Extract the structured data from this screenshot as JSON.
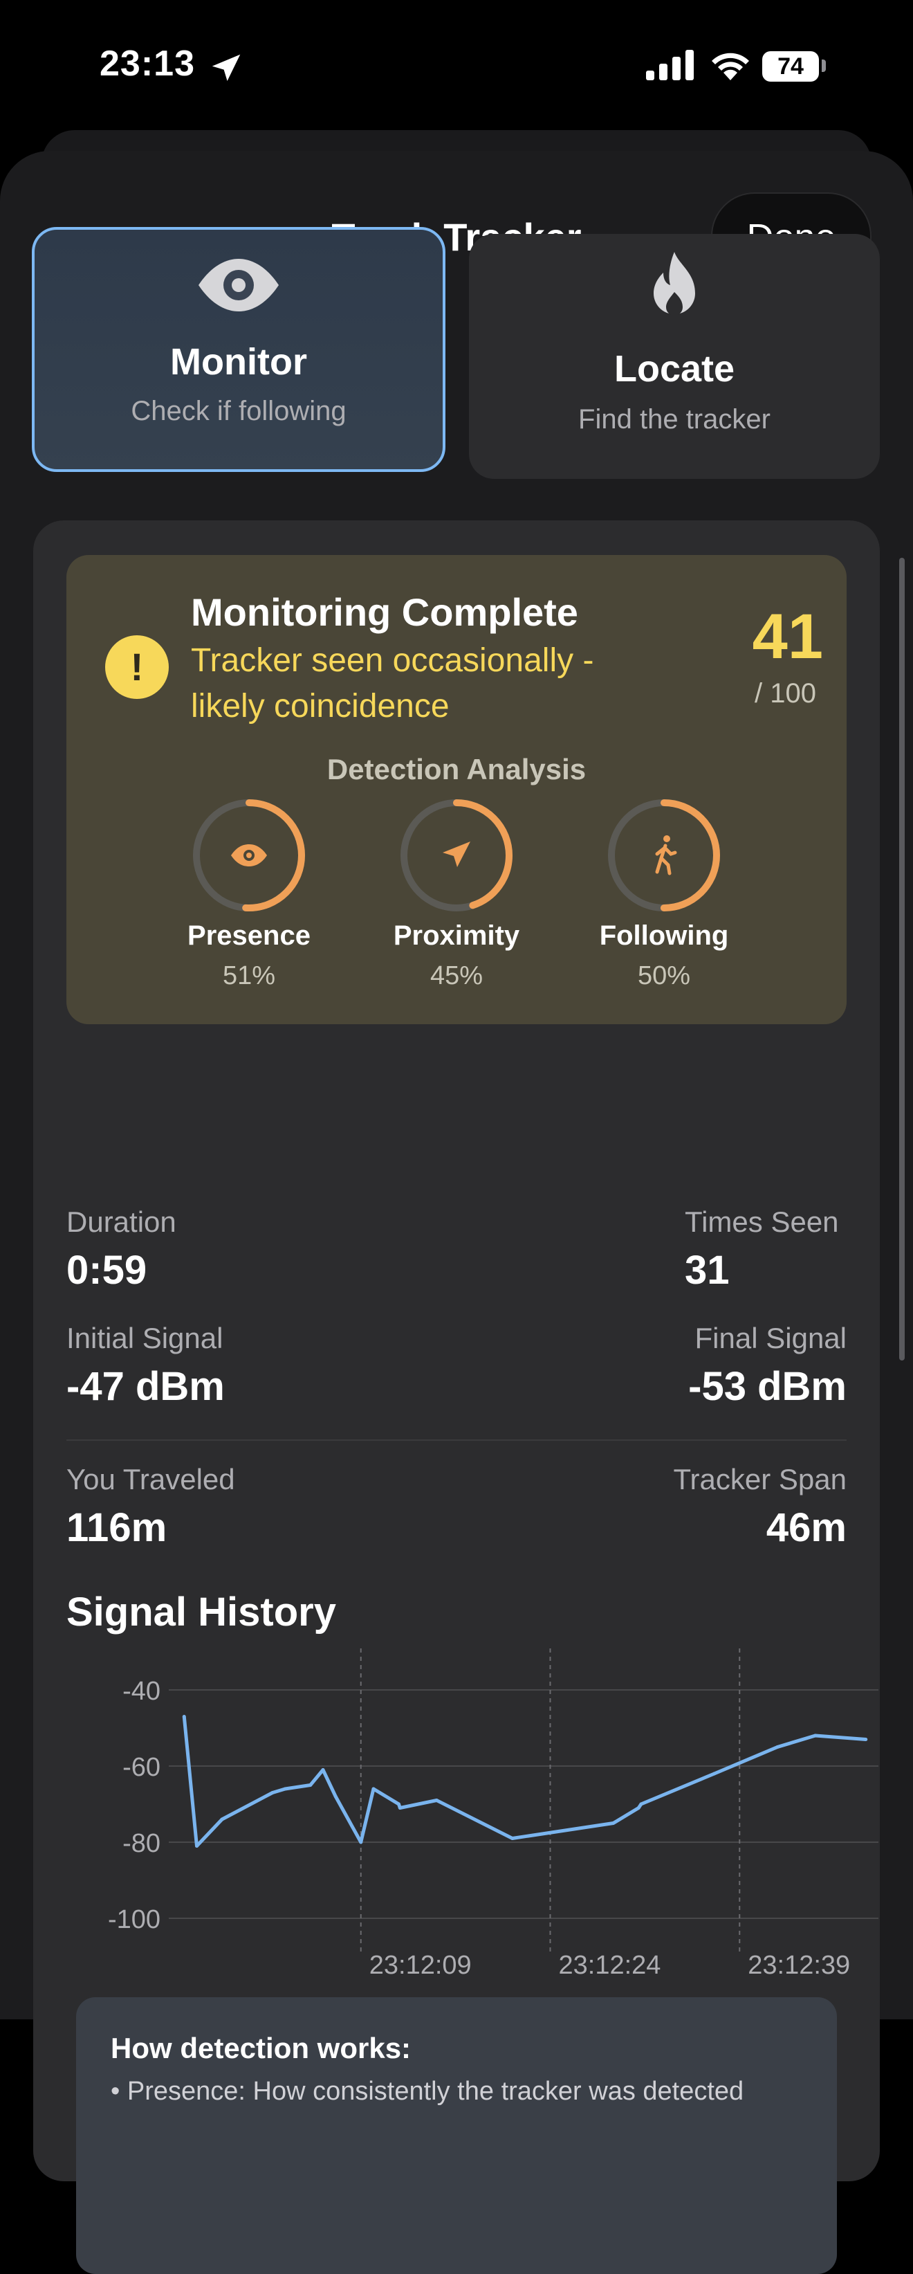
{
  "status_bar": {
    "time": "23:13",
    "battery": "74"
  },
  "sheet": {
    "title": "Track Tracker",
    "done_label": "Done"
  },
  "modes": [
    {
      "title": "Monitor",
      "subtitle": "Check if following",
      "icon": "eye-icon",
      "active": true
    },
    {
      "title": "Locate",
      "subtitle": "Find the tracker",
      "icon": "flame-icon",
      "active": false
    }
  ],
  "verdict": {
    "title": "Monitoring Complete",
    "subtitle": "Tracker seen occasionally - likely coincidence",
    "score": "41",
    "score_max": "/ 100",
    "analysis_title": "Detection Analysis",
    "metrics": [
      {
        "label": "Presence",
        "value": "51%",
        "fraction": 0.51,
        "icon": "eye-icon"
      },
      {
        "label": "Proximity",
        "value": "45%",
        "fraction": 0.45,
        "icon": "location-arrow-icon"
      },
      {
        "label": "Following",
        "value": "50%",
        "fraction": 0.5,
        "icon": "walking-person-icon"
      }
    ],
    "accent_color": "#f7d85a",
    "ring_color": "#f0a057"
  },
  "stats": {
    "duration_label": "Duration",
    "duration": "0:59",
    "times_seen_label": "Times Seen",
    "times_seen": "31",
    "initial_signal_label": "Initial Signal",
    "initial_signal": "-47 dBm",
    "final_signal_label": "Final Signal",
    "final_signal": "-53 dBm",
    "you_traveled_label": "You Traveled",
    "you_traveled": "116m",
    "tracker_span_label": "Tracker Span",
    "tracker_span": "46m"
  },
  "signal_history": {
    "title": "Signal History",
    "line_color": "#7ab4ee"
  },
  "chart_data": {
    "type": "line",
    "title": "Signal History",
    "xlabel": "",
    "ylabel": "",
    "ylim": [
      -100,
      -40
    ],
    "xlim": [
      23.1177,
      23.1208
    ],
    "y_ticks": [
      -40,
      -60,
      -80,
      -100
    ],
    "x_ticks": [
      "23:12:09",
      "23:12:24",
      "23:12:39"
    ],
    "x_tick_seconds": [
      729,
      744,
      759
    ],
    "series": [
      {
        "x_seconds": [
          715,
          716,
          718,
          722,
          723,
          725,
          726,
          727,
          729,
          730,
          732,
          732.1,
          735,
          741,
          749,
          751,
          751.2,
          757,
          762,
          765,
          769
        ],
        "values": [
          -47,
          -81,
          -74,
          -67,
          -66,
          -65,
          -61,
          -68,
          -80,
          -66,
          -70,
          -71,
          -69,
          -79,
          -75,
          -71,
          -70,
          -62,
          -55,
          -52,
          -53
        ]
      }
    ],
    "grid": true
  },
  "info": {
    "title": "How detection works:",
    "line1": "• Presence: How consistently the tracker was detected"
  }
}
